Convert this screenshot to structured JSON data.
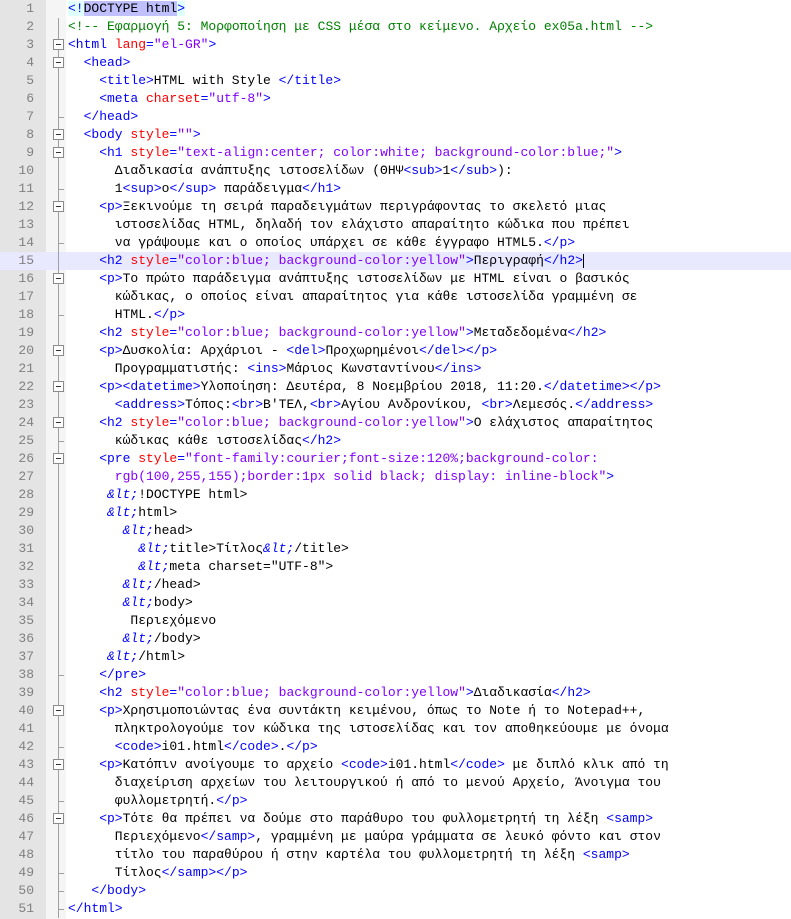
{
  "editor": {
    "current_line": 15,
    "lines": [
      {
        "n": "1",
        "fold": "",
        "indent": 0,
        "toks": [
          [
            "doc",
            "<!"
          ],
          [
            "sel",
            "DOCTYPE html"
          ],
          [
            "doc",
            ">"
          ]
        ]
      },
      {
        "n": "2",
        "fold": "line",
        "indent": 0,
        "toks": [
          [
            "com",
            "<!-- Εφαρμογή 5: Μορφοποίηση με CSS μέσα στο κείμενο. Αρχείο ex05a.html -->"
          ]
        ]
      },
      {
        "n": "3",
        "fold": "open",
        "indent": 0,
        "toks": [
          [
            "tag",
            "<html "
          ],
          [
            "attr",
            "lang"
          ],
          [
            "tag",
            "="
          ],
          [
            "val",
            "\"el-GR\""
          ],
          [
            "tag",
            ">"
          ]
        ]
      },
      {
        "n": "4",
        "fold": "open",
        "indent": 2,
        "toks": [
          [
            "tag",
            "<head>"
          ]
        ]
      },
      {
        "n": "5",
        "fold": "line",
        "indent": 4,
        "toks": [
          [
            "tag",
            "<title>"
          ],
          [
            "txt",
            "HTML with Style "
          ],
          [
            "tag",
            "</title>"
          ]
        ]
      },
      {
        "n": "6",
        "fold": "line",
        "indent": 4,
        "toks": [
          [
            "tag",
            "<meta "
          ],
          [
            "attr",
            "charset"
          ],
          [
            "tag",
            "="
          ],
          [
            "val",
            "\"utf-8\""
          ],
          [
            "tag",
            ">"
          ]
        ]
      },
      {
        "n": "7",
        "fold": "end",
        "indent": 2,
        "toks": [
          [
            "tag",
            "</head>"
          ]
        ]
      },
      {
        "n": "8",
        "fold": "open",
        "indent": 2,
        "toks": [
          [
            "tag",
            "<body "
          ],
          [
            "attr",
            "style"
          ],
          [
            "tag",
            "="
          ],
          [
            "val",
            "\"\""
          ],
          [
            "tag",
            ">"
          ]
        ]
      },
      {
        "n": "9",
        "fold": "open",
        "indent": 4,
        "toks": [
          [
            "tag",
            "<h1 "
          ],
          [
            "attr",
            "style"
          ],
          [
            "tag",
            "="
          ],
          [
            "val",
            "\"text-align:center; color:white; background-color:blue;\""
          ],
          [
            "tag",
            ">"
          ]
        ]
      },
      {
        "n": "10",
        "fold": "line",
        "indent": 6,
        "toks": [
          [
            "txt",
            "Διαδικασία ανάπτυξης ιστοσελίδων (ΘΗΨ"
          ],
          [
            "tag",
            "<sub>"
          ],
          [
            "txt",
            "1"
          ],
          [
            "tag",
            "</sub>"
          ],
          [
            "txt",
            "):"
          ]
        ]
      },
      {
        "n": "11",
        "fold": "end",
        "indent": 6,
        "toks": [
          [
            "txt",
            "1"
          ],
          [
            "tag",
            "<sup>"
          ],
          [
            "txt",
            "ο"
          ],
          [
            "tag",
            "</sup>"
          ],
          [
            "txt",
            " παράδειγμα"
          ],
          [
            "tag",
            "</h1>"
          ]
        ]
      },
      {
        "n": "12",
        "fold": "open",
        "indent": 4,
        "toks": [
          [
            "tag",
            "<p>"
          ],
          [
            "txt",
            "Ξεκινούμε τη σειρά παραδειγμάτων περιγράφοντας το σκελετό μιας"
          ]
        ]
      },
      {
        "n": "13",
        "fold": "line",
        "indent": 6,
        "toks": [
          [
            "txt",
            "ιστοσελίδας HTML, δηλαδή τον ελάχιστο απαραίτητο κώδικα που πρέπει"
          ]
        ]
      },
      {
        "n": "14",
        "fold": "end",
        "indent": 6,
        "toks": [
          [
            "txt",
            "να γράψουμε και ο οποίος υπάρχει σε κάθε έγγραφο HTML5."
          ],
          [
            "tag",
            "</p>"
          ]
        ]
      },
      {
        "n": "15",
        "fold": "line",
        "indent": 4,
        "toks": [
          [
            "tag",
            "<h2 "
          ],
          [
            "attr",
            "style"
          ],
          [
            "tag",
            "="
          ],
          [
            "val",
            "\"color:blue; background-color:yellow\""
          ],
          [
            "tag",
            ">"
          ],
          [
            "txt",
            "Περιγραφή"
          ],
          [
            "tag",
            "</h2>"
          ],
          [
            "caret",
            ""
          ]
        ]
      },
      {
        "n": "16",
        "fold": "open",
        "indent": 4,
        "toks": [
          [
            "tag",
            "<p>"
          ],
          [
            "txt",
            "Το πρώτο παράδειγμα ανάπτυξης ιστοσελίδων με HTML είναι ο βασικός"
          ]
        ]
      },
      {
        "n": "17",
        "fold": "line",
        "indent": 6,
        "toks": [
          [
            "txt",
            "κώδικας, ο οποίος είναι απαραίτητος για κάθε ιστοσελίδα γραμμένη σε"
          ]
        ]
      },
      {
        "n": "18",
        "fold": "end",
        "indent": 6,
        "toks": [
          [
            "txt",
            "HTML."
          ],
          [
            "tag",
            "</p>"
          ]
        ]
      },
      {
        "n": "19",
        "fold": "line",
        "indent": 4,
        "toks": [
          [
            "tag",
            "<h2 "
          ],
          [
            "attr",
            "style"
          ],
          [
            "tag",
            "="
          ],
          [
            "val",
            "\"color:blue; background-color:yellow\""
          ],
          [
            "tag",
            ">"
          ],
          [
            "txt",
            "Μεταδεδομένα"
          ],
          [
            "tag",
            "</h2>"
          ]
        ]
      },
      {
        "n": "20",
        "fold": "open",
        "indent": 4,
        "toks": [
          [
            "tag",
            "<p>"
          ],
          [
            "txt",
            "Δυσκολία: Αρχάριοι - "
          ],
          [
            "tag",
            "<del>"
          ],
          [
            "txt",
            "Προχωρημένοι"
          ],
          [
            "tag",
            "</del></p>"
          ]
        ]
      },
      {
        "n": "21",
        "fold": "line",
        "indent": 6,
        "toks": [
          [
            "txt",
            "Προγραμματιστής: "
          ],
          [
            "tag",
            "<ins>"
          ],
          [
            "txt",
            "Μάριος Κωνσταντίνου"
          ],
          [
            "tag",
            "</ins>"
          ]
        ]
      },
      {
        "n": "22",
        "fold": "open",
        "indent": 4,
        "toks": [
          [
            "tag",
            "<p><datetime>"
          ],
          [
            "txt",
            "Υλοποίηση: Δευτέρα, 8 Νοεμβρίου 2018, 11:20."
          ],
          [
            "tag",
            "</datetime></p>"
          ]
        ]
      },
      {
        "n": "23",
        "fold": "line",
        "indent": 6,
        "toks": [
          [
            "tag",
            "<address>"
          ],
          [
            "txt",
            "Τόπος:"
          ],
          [
            "tag",
            "<br>"
          ],
          [
            "txt",
            "Β'ΤΕΛ,"
          ],
          [
            "tag",
            "<br>"
          ],
          [
            "txt",
            "Αγίου Ανδρονίκου, "
          ],
          [
            "tag",
            "<br>"
          ],
          [
            "txt",
            "Λεμεσός."
          ],
          [
            "tag",
            "</address>"
          ]
        ]
      },
      {
        "n": "24",
        "fold": "open",
        "indent": 4,
        "toks": [
          [
            "tag",
            "<h2 "
          ],
          [
            "attr",
            "style"
          ],
          [
            "tag",
            "="
          ],
          [
            "val",
            "\"color:blue; background-color:yellow\""
          ],
          [
            "tag",
            ">"
          ],
          [
            "txt",
            "Ο ελάχιστος απαραίτητος"
          ]
        ]
      },
      {
        "n": "25",
        "fold": "end",
        "indent": 6,
        "toks": [
          [
            "txt",
            "κώδικας κάθε ιστοσελίδας"
          ],
          [
            "tag",
            "</h2>"
          ]
        ]
      },
      {
        "n": "26",
        "fold": "open",
        "indent": 4,
        "toks": [
          [
            "tag",
            "<pre "
          ],
          [
            "attr",
            "style"
          ],
          [
            "tag",
            "="
          ],
          [
            "val",
            "\"font-family:courier;font-size:120%;background-color:"
          ]
        ]
      },
      {
        "n": "27",
        "fold": "line",
        "indent": 6,
        "toks": [
          [
            "val",
            "rgb(100,255,155);border:1px solid black; display: inline-block\""
          ],
          [
            "tag",
            ">"
          ]
        ]
      },
      {
        "n": "28",
        "fold": "line",
        "indent": 5,
        "toks": [
          [
            "ent",
            "&lt;"
          ],
          [
            "txt",
            "!DOCTYPE html>"
          ]
        ]
      },
      {
        "n": "29",
        "fold": "line",
        "indent": 5,
        "toks": [
          [
            "ent",
            "&lt;"
          ],
          [
            "txt",
            "html>"
          ]
        ]
      },
      {
        "n": "30",
        "fold": "line",
        "indent": 7,
        "toks": [
          [
            "ent",
            "&lt;"
          ],
          [
            "txt",
            "head>"
          ]
        ]
      },
      {
        "n": "31",
        "fold": "line",
        "indent": 9,
        "toks": [
          [
            "ent",
            "&lt;"
          ],
          [
            "txt",
            "title>Τίτλος"
          ],
          [
            "ent",
            "&lt;"
          ],
          [
            "txt",
            "/title>"
          ]
        ]
      },
      {
        "n": "32",
        "fold": "line",
        "indent": 9,
        "toks": [
          [
            "ent",
            "&lt;"
          ],
          [
            "txt",
            "meta charset=\"UTF-8\">"
          ]
        ]
      },
      {
        "n": "33",
        "fold": "line",
        "indent": 7,
        "toks": [
          [
            "ent",
            "&lt;"
          ],
          [
            "txt",
            "/head>"
          ]
        ]
      },
      {
        "n": "34",
        "fold": "line",
        "indent": 7,
        "toks": [
          [
            "ent",
            "&lt;"
          ],
          [
            "txt",
            "body>"
          ]
        ]
      },
      {
        "n": "35",
        "fold": "line",
        "indent": 8,
        "toks": [
          [
            "txt",
            "Περιεχόμενο"
          ]
        ]
      },
      {
        "n": "36",
        "fold": "line",
        "indent": 7,
        "toks": [
          [
            "ent",
            "&lt;"
          ],
          [
            "txt",
            "/body>"
          ]
        ]
      },
      {
        "n": "37",
        "fold": "line",
        "indent": 5,
        "toks": [
          [
            "ent",
            "&lt;"
          ],
          [
            "txt",
            "/html>"
          ]
        ]
      },
      {
        "n": "38",
        "fold": "end",
        "indent": 4,
        "toks": [
          [
            "tag",
            "</pre>"
          ]
        ]
      },
      {
        "n": "39",
        "fold": "line",
        "indent": 4,
        "toks": [
          [
            "tag",
            "<h2 "
          ],
          [
            "attr",
            "style"
          ],
          [
            "tag",
            "="
          ],
          [
            "val",
            "\"color:blue; background-color:yellow\""
          ],
          [
            "tag",
            ">"
          ],
          [
            "txt",
            "Διαδικασία"
          ],
          [
            "tag",
            "</h2>"
          ]
        ]
      },
      {
        "n": "40",
        "fold": "open",
        "indent": 4,
        "toks": [
          [
            "tag",
            "<p>"
          ],
          [
            "txt",
            "Χρησιμοποιώντας ένα συντάκτη κειμένου, όπως το Note ή το Notepad++,"
          ]
        ]
      },
      {
        "n": "41",
        "fold": "line",
        "indent": 6,
        "toks": [
          [
            "txt",
            "πληκτρολογούμε τον κώδικα της ιστοσελίδας και τον αποθηκεύουμε με όνομα"
          ]
        ]
      },
      {
        "n": "42",
        "fold": "end",
        "indent": 6,
        "toks": [
          [
            "tag",
            "<code>"
          ],
          [
            "txt",
            "i01.html"
          ],
          [
            "tag",
            "</code>"
          ],
          [
            "txt",
            "."
          ],
          [
            "tag",
            "</p>"
          ]
        ]
      },
      {
        "n": "43",
        "fold": "open",
        "indent": 4,
        "toks": [
          [
            "tag",
            "<p>"
          ],
          [
            "txt",
            "Κατόπιν ανοίγουμε το αρχείο "
          ],
          [
            "tag",
            "<code>"
          ],
          [
            "txt",
            "i01.html"
          ],
          [
            "tag",
            "</code>"
          ],
          [
            "txt",
            " με διπλό κλικ από τη"
          ]
        ]
      },
      {
        "n": "44",
        "fold": "line",
        "indent": 6,
        "toks": [
          [
            "txt",
            "διαχείριση αρχείων του λειτουργικού ή από το μενού Αρχείο, Άνοιγμα του"
          ]
        ]
      },
      {
        "n": "45",
        "fold": "end",
        "indent": 6,
        "toks": [
          [
            "txt",
            "φυλλομετρητή."
          ],
          [
            "tag",
            "</p>"
          ]
        ]
      },
      {
        "n": "46",
        "fold": "open",
        "indent": 4,
        "toks": [
          [
            "tag",
            "<p>"
          ],
          [
            "txt",
            "Τότε θα πρέπει να δούμε στο παράθυρο του φυλλομετρητή τη λέξη "
          ],
          [
            "tag",
            "<samp>"
          ]
        ]
      },
      {
        "n": "47",
        "fold": "line",
        "indent": 6,
        "toks": [
          [
            "txt",
            "Περιεχόμενο"
          ],
          [
            "tag",
            "</samp>"
          ],
          [
            "txt",
            ", γραμμένη με μαύρα γράμματα σε λευκό φόντο και στον"
          ]
        ]
      },
      {
        "n": "48",
        "fold": "line",
        "indent": 6,
        "toks": [
          [
            "txt",
            "τίτλο του παραθύρου ή στην καρτέλα του φυλλομετρητή τη λέξη "
          ],
          [
            "tag",
            "<samp>"
          ]
        ]
      },
      {
        "n": "49",
        "fold": "end",
        "indent": 6,
        "toks": [
          [
            "txt",
            "Τίτλος"
          ],
          [
            "tag",
            "</samp></p>"
          ]
        ]
      },
      {
        "n": "50",
        "fold": "end",
        "indent": 3,
        "toks": [
          [
            "tag",
            "</body>"
          ]
        ]
      },
      {
        "n": "51",
        "fold": "end",
        "indent": 0,
        "toks": [
          [
            "tag",
            "</html>"
          ]
        ]
      }
    ]
  }
}
